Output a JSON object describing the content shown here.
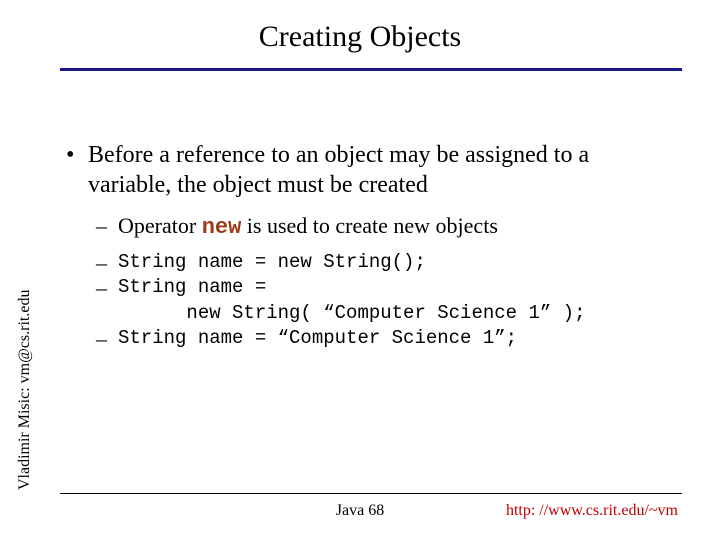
{
  "title": "Creating Objects",
  "bullet1": "Before a reference to an object may be assigned to a variable, the object must be created",
  "bullet2_pre": "Operator ",
  "bullet2_kw": "new",
  "bullet2_post": " is used to create new objects",
  "code": {
    "l1": "String name = new String();",
    "l2": "String name =",
    "l3": "      new String( “Computer Science 1” );",
    "l4": "String name = “Computer Science 1”;"
  },
  "sidetext": "Vladimir Misic: vm@cs.rit.edu",
  "footer_center": "Java 68",
  "footer_right": "http: //www.cs.rit.edu/~vm",
  "dash": "–",
  "dot": "•"
}
